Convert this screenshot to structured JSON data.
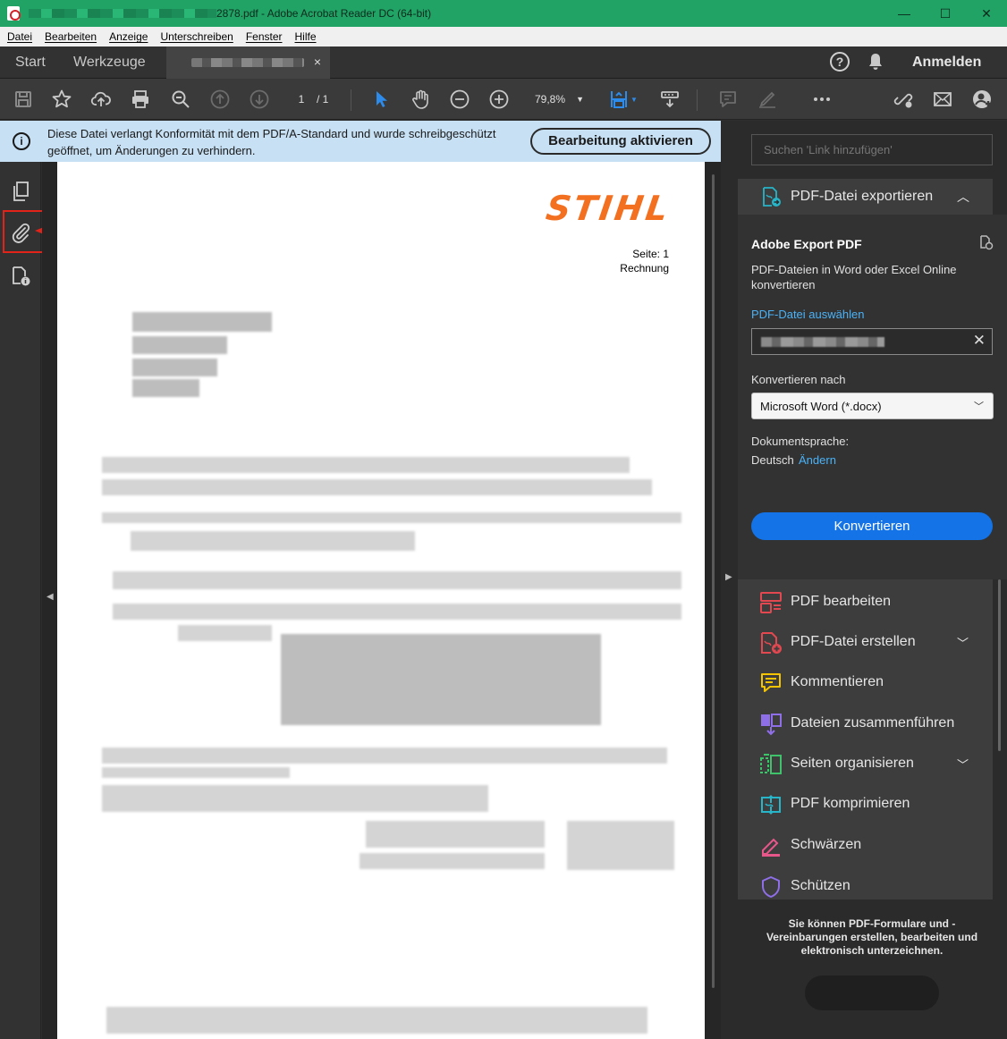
{
  "titlebar": {
    "title_suffix": "2878.pdf - Adobe Acrobat Reader DC (64-bit)",
    "minimize": "—",
    "maximize": "☐",
    "close": "✕"
  },
  "menu": [
    "Datei",
    "Bearbeiten",
    "Anzeige",
    "Unterschreiben",
    "Fenster",
    "Hilfe"
  ],
  "tabs": {
    "start": "Start",
    "tools": "Werkzeuge",
    "close": "×",
    "help": "?",
    "signin": "Anmelden"
  },
  "toolbar": {
    "page_current": "1",
    "page_total": "/ 1",
    "zoom": "79,8%"
  },
  "notice": {
    "text": "Diese Datei verlangt Konformität mit dem PDF/A-Standard und wurde schreibgeschützt geöffnet, um Änderungen zu verhindern.",
    "button": "Bearbeitung aktivieren"
  },
  "document": {
    "logo": "STIHL",
    "page_label": "Seite: 1",
    "doc_type": "Rechnung"
  },
  "right_pane": {
    "search_placeholder": "Suchen 'Link hinzufügen'",
    "export_header": "PDF-Datei exportieren",
    "export_title": "Adobe Export PDF",
    "export_desc": "PDF-Dateien in Word oder Excel Online konvertieren",
    "select_file": "PDF-Datei auswählen",
    "convert_to_label": "Konvertieren nach",
    "format": "Microsoft Word (*.docx)",
    "lang_label": "Dokumentsprache:",
    "lang_value": "Deutsch",
    "lang_change": "Ändern",
    "convert_button": "Konvertieren",
    "tools": [
      {
        "label": "PDF bearbeiten",
        "icon": "edit-pdf-icon",
        "color": "#e34850"
      },
      {
        "label": "PDF-Datei erstellen",
        "icon": "create-pdf-icon",
        "color": "#e34850"
      },
      {
        "label": "Kommentieren",
        "icon": "comment-icon",
        "color": "#f5c400"
      },
      {
        "label": "Dateien zusammenführen",
        "icon": "combine-files-icon",
        "color": "#8f6fe8"
      },
      {
        "label": "Seiten organisieren",
        "icon": "organize-pages-icon",
        "color": "#3ec36a"
      },
      {
        "label": "PDF komprimieren",
        "icon": "compress-pdf-icon",
        "color": "#e34850"
      },
      {
        "label": "Schwärzen",
        "icon": "redact-icon",
        "color": "#e8578a"
      },
      {
        "label": "Schützen",
        "icon": "protect-icon",
        "color": "#8f6fe8"
      }
    ],
    "promo": "Sie können PDF-Formulare und -Vereinbarungen erstellen, bearbeiten und elektronisch unterzeichnen."
  },
  "colors": {
    "titlebar": "#21a366",
    "notice": "#c7e0f4",
    "accent_blue": "#1473e6",
    "stihl_orange": "#f37021",
    "highlight_red": "#e2231a"
  }
}
